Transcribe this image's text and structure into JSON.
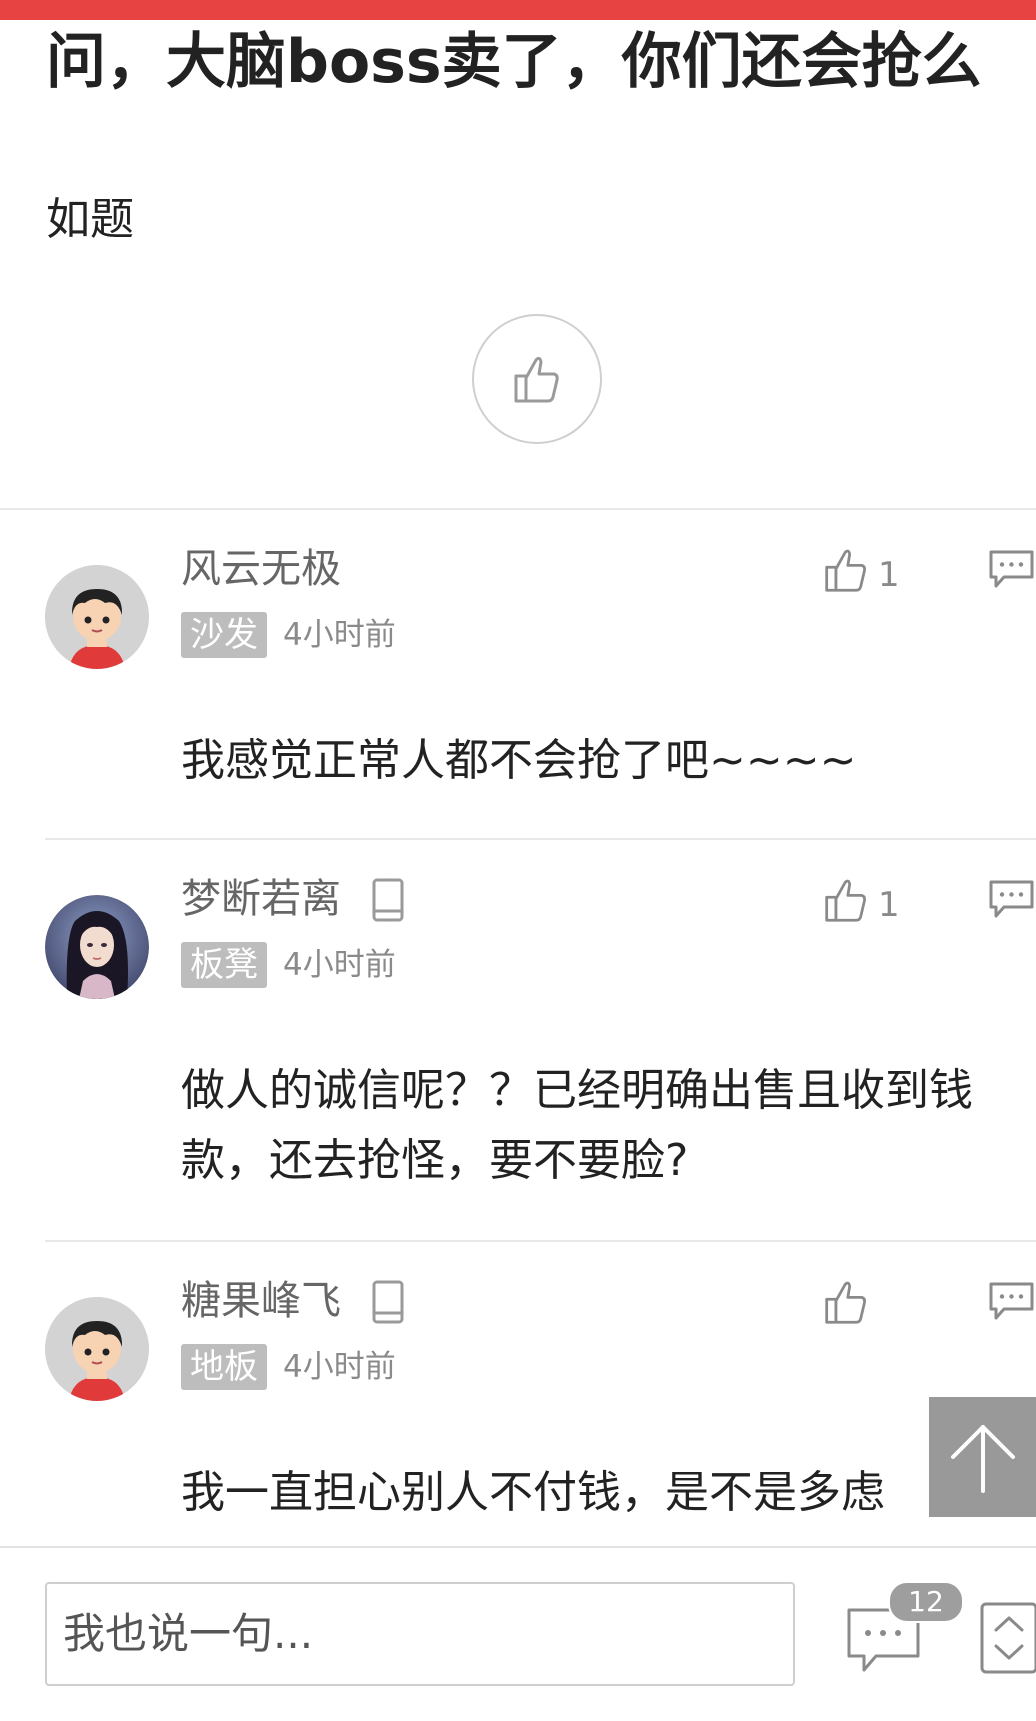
{
  "post": {
    "title": "问，大脑boss卖了，你们还会抢么",
    "body": "如题"
  },
  "comments": [
    {
      "username": "风云无极",
      "floor": "沙发",
      "time": "4小时前",
      "likes": "1",
      "text": "我感觉正常人都不会抢了吧~~~~",
      "avatar": "cartoon-boy",
      "mobile": false
    },
    {
      "username": "梦断若离",
      "floor": "板凳",
      "time": "4小时前",
      "likes": "1",
      "text": "做人的诚信呢？？已经明确出售且收到钱款，还去抢怪，要不要脸?",
      "avatar": "anime-girl",
      "mobile": true
    },
    {
      "username": "糖果峰飞",
      "floor": "地板",
      "time": "4小时前",
      "likes": "",
      "text": "我一直担心别人不付钱，是不是多虑",
      "avatar": "cartoon-boy",
      "mobile": true
    }
  ],
  "bottom_bar": {
    "input_placeholder": "我也说一句...",
    "comment_count": "12"
  },
  "colors": {
    "accent": "#e84343",
    "badge_gray": "#bdbdbd",
    "text_dark": "#222222",
    "text_meta": "#8a8a8a"
  },
  "icons": [
    "thumbs-up-icon",
    "reply-bubble-icon",
    "phone-icon",
    "arrow-up-icon",
    "comment-bubble-icon",
    "sort-toggle-icon"
  ]
}
